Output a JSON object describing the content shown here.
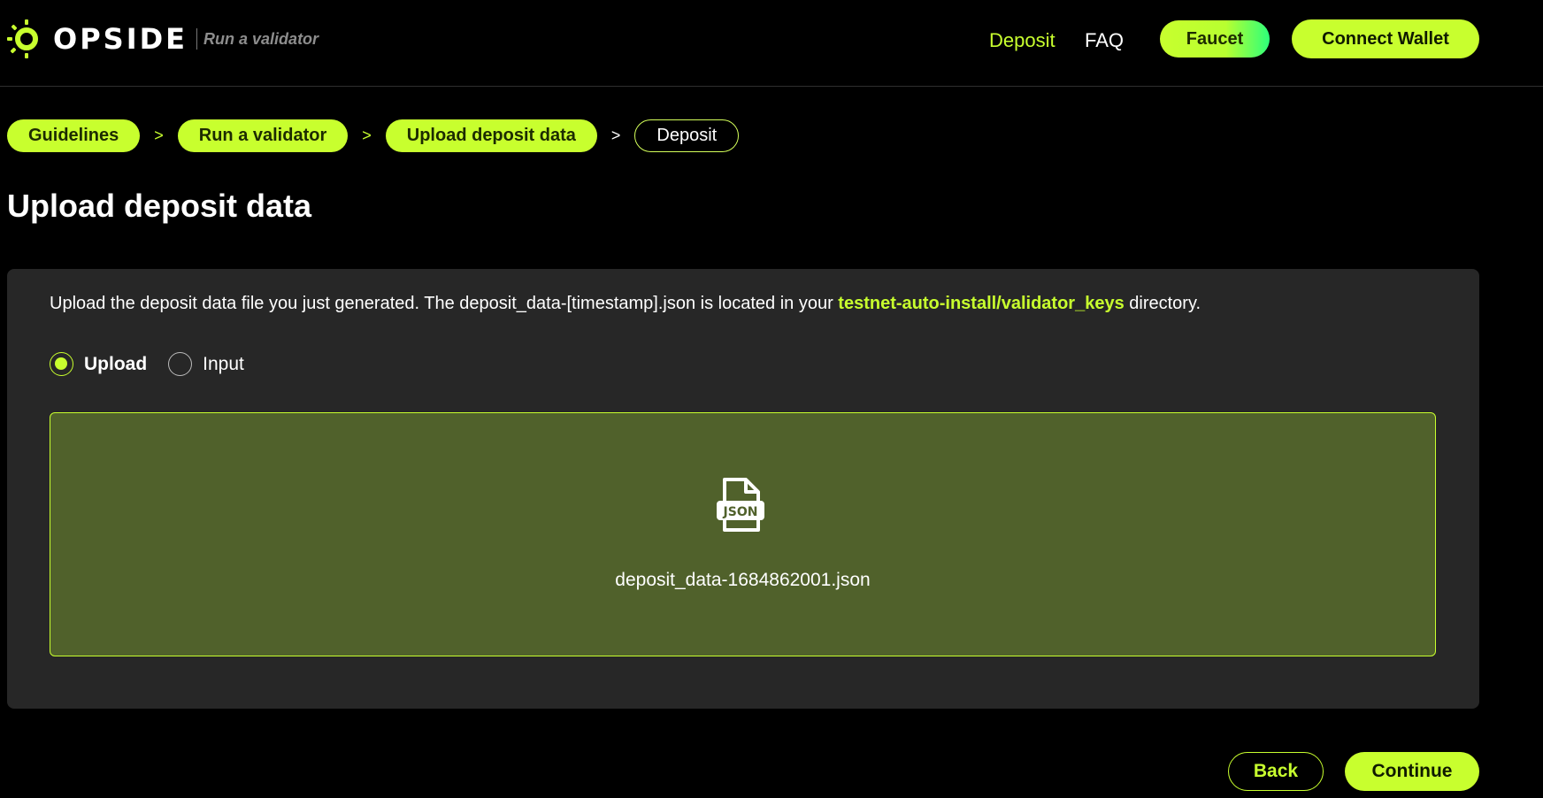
{
  "header": {
    "logo_text": "OPSIDE",
    "logo_subtitle": "Run a validator",
    "nav": {
      "deposit": "Deposit",
      "faq": "FAQ"
    },
    "faucet_label": "Faucet",
    "connect_wallet_label": "Connect Wallet"
  },
  "breadcrumb": {
    "items": [
      {
        "label": "Guidelines",
        "state": "completed"
      },
      {
        "label": "Run a validator",
        "state": "completed"
      },
      {
        "label": "Upload deposit data",
        "state": "completed"
      },
      {
        "label": "Deposit",
        "state": "current"
      }
    ],
    "separator": ">"
  },
  "page_title": "Upload deposit data",
  "card": {
    "description_prefix": "Upload the deposit data file you just generated. The deposit_data-[timestamp].json is located in your ",
    "description_highlight": "testnet-auto-install/validator_keys",
    "description_suffix": " directory.",
    "mode_options": [
      {
        "label": "Upload",
        "checked": true
      },
      {
        "label": "Input",
        "checked": false
      }
    ],
    "dropzone": {
      "icon": "json-file-icon",
      "icon_text": "JSON",
      "file_name": "deposit_data-1684862001.json"
    }
  },
  "footer": {
    "back_label": "Back",
    "continue_label": "Continue"
  },
  "colors": {
    "accent": "#c8ff2e",
    "background": "#000000",
    "card": "#272727",
    "dropzone": "#50612b"
  }
}
